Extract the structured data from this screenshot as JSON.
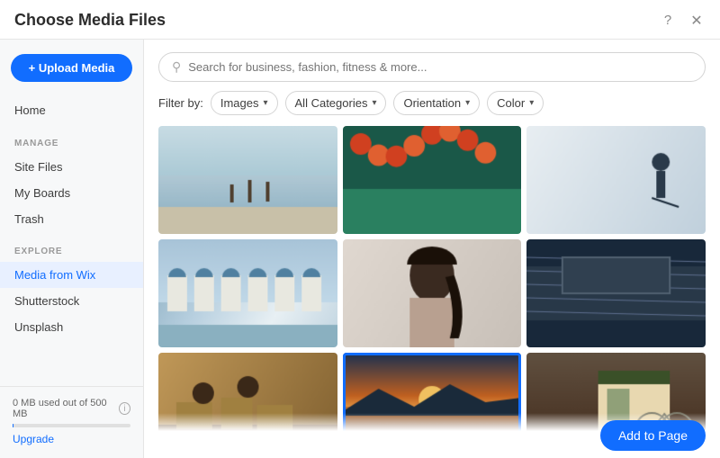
{
  "titleBar": {
    "title": "Choose Media Files",
    "helpLabel": "?",
    "closeLabel": "✕"
  },
  "sidebar": {
    "uploadButton": "+ Upload Media",
    "homeLabel": "Home",
    "manageSection": "MANAGE",
    "manageItems": [
      {
        "label": "Site Files",
        "id": "site-files"
      },
      {
        "label": "My Boards",
        "id": "my-boards"
      },
      {
        "label": "Trash",
        "id": "trash"
      }
    ],
    "exploreSection": "EXPLORE",
    "exploreItems": [
      {
        "label": "Media from Wix",
        "id": "media-from-wix",
        "active": true
      },
      {
        "label": "Shutterstock",
        "id": "shutterstock"
      },
      {
        "label": "Unsplash",
        "id": "unsplash"
      }
    ],
    "storageText": "0 MB used out of 500 MB",
    "upgradeLabel": "Upgrade"
  },
  "search": {
    "placeholder": "Search for business, fashion, fitness & more..."
  },
  "filters": {
    "filterByLabel": "Filter by:",
    "dropdowns": [
      {
        "label": "Images"
      },
      {
        "label": "All Categories"
      },
      {
        "label": "Orientation"
      },
      {
        "label": "Color"
      }
    ]
  },
  "images": [
    {
      "id": "img1",
      "selected": false,
      "colors": [
        "#c8d4da",
        "#a8bfc7",
        "#8baab5"
      ]
    },
    {
      "id": "img2",
      "selected": false,
      "colors": [
        "#d44a2a",
        "#e87040",
        "#3a8a7a"
      ]
    },
    {
      "id": "img3",
      "selected": false,
      "colors": [
        "#e8eef2",
        "#c5d5df",
        "#d0dfe8"
      ]
    },
    {
      "id": "img4",
      "selected": false,
      "colors": [
        "#b8cfe0",
        "#8aadc0",
        "#6a9ab5"
      ]
    },
    {
      "id": "img5",
      "selected": false,
      "colors": [
        "#d8cfc8",
        "#c0b8b0",
        "#e0d8d0"
      ]
    },
    {
      "id": "img6",
      "selected": false,
      "colors": [
        "#1a2a3a",
        "#2a3a5a",
        "#3a4a6a"
      ]
    },
    {
      "id": "img7",
      "selected": false,
      "colors": [
        "#b89060",
        "#c8a870",
        "#d4b880"
      ]
    },
    {
      "id": "img8",
      "selected": true,
      "colors": [
        "#1a4060",
        "#2a6080",
        "#4a8090"
      ]
    },
    {
      "id": "img9",
      "selected": false,
      "colors": [
        "#504030",
        "#605040",
        "#806050"
      ]
    }
  ],
  "addToPageButton": "Add to Page"
}
